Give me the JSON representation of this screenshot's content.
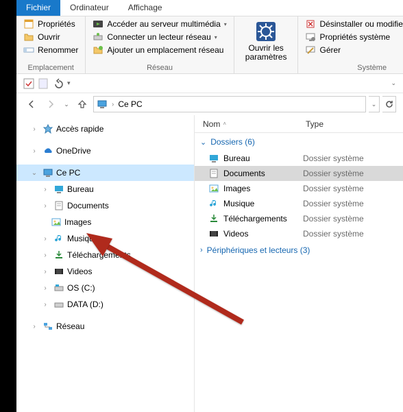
{
  "tabs": {
    "file": "Fichier",
    "computer": "Ordinateur",
    "view": "Affichage"
  },
  "ribbon": {
    "location": {
      "label": "Emplacement",
      "properties": "Propriétés",
      "open": "Ouvrir",
      "rename": "Renommer"
    },
    "network": {
      "label": "Réseau",
      "media": "Accéder au serveur multimédia",
      "connect": "Connecter un lecteur réseau",
      "addloc": "Ajouter un emplacement réseau"
    },
    "openparams": {
      "line1": "Ouvrir les",
      "line2": "paramètres"
    },
    "system": {
      "label": "Système",
      "uninstall": "Désinstaller ou modifier un progr",
      "sysprops": "Propriétés système",
      "manage": "Gérer"
    }
  },
  "address": {
    "location": "Ce PC"
  },
  "tree": {
    "quick": "Accès rapide",
    "onedrive": "OneDrive",
    "thispc": "Ce PC",
    "desktop": "Bureau",
    "documents": "Documents",
    "images": "Images",
    "music": "Musique",
    "downloads": "Téléchargements",
    "videos": "Videos",
    "osc": "OS (C:)",
    "datad": "DATA (D:)",
    "network": "Réseau"
  },
  "list": {
    "cols": {
      "name": "Nom",
      "type": "Type"
    },
    "group_folders": "Dossiers (6)",
    "group_drives": "Périphériques et lecteurs (3)",
    "type_sys": "Dossier système",
    "items": {
      "desktop": "Bureau",
      "documents": "Documents",
      "images": "Images",
      "music": "Musique",
      "downloads": "Téléchargements",
      "videos": "Videos"
    }
  }
}
